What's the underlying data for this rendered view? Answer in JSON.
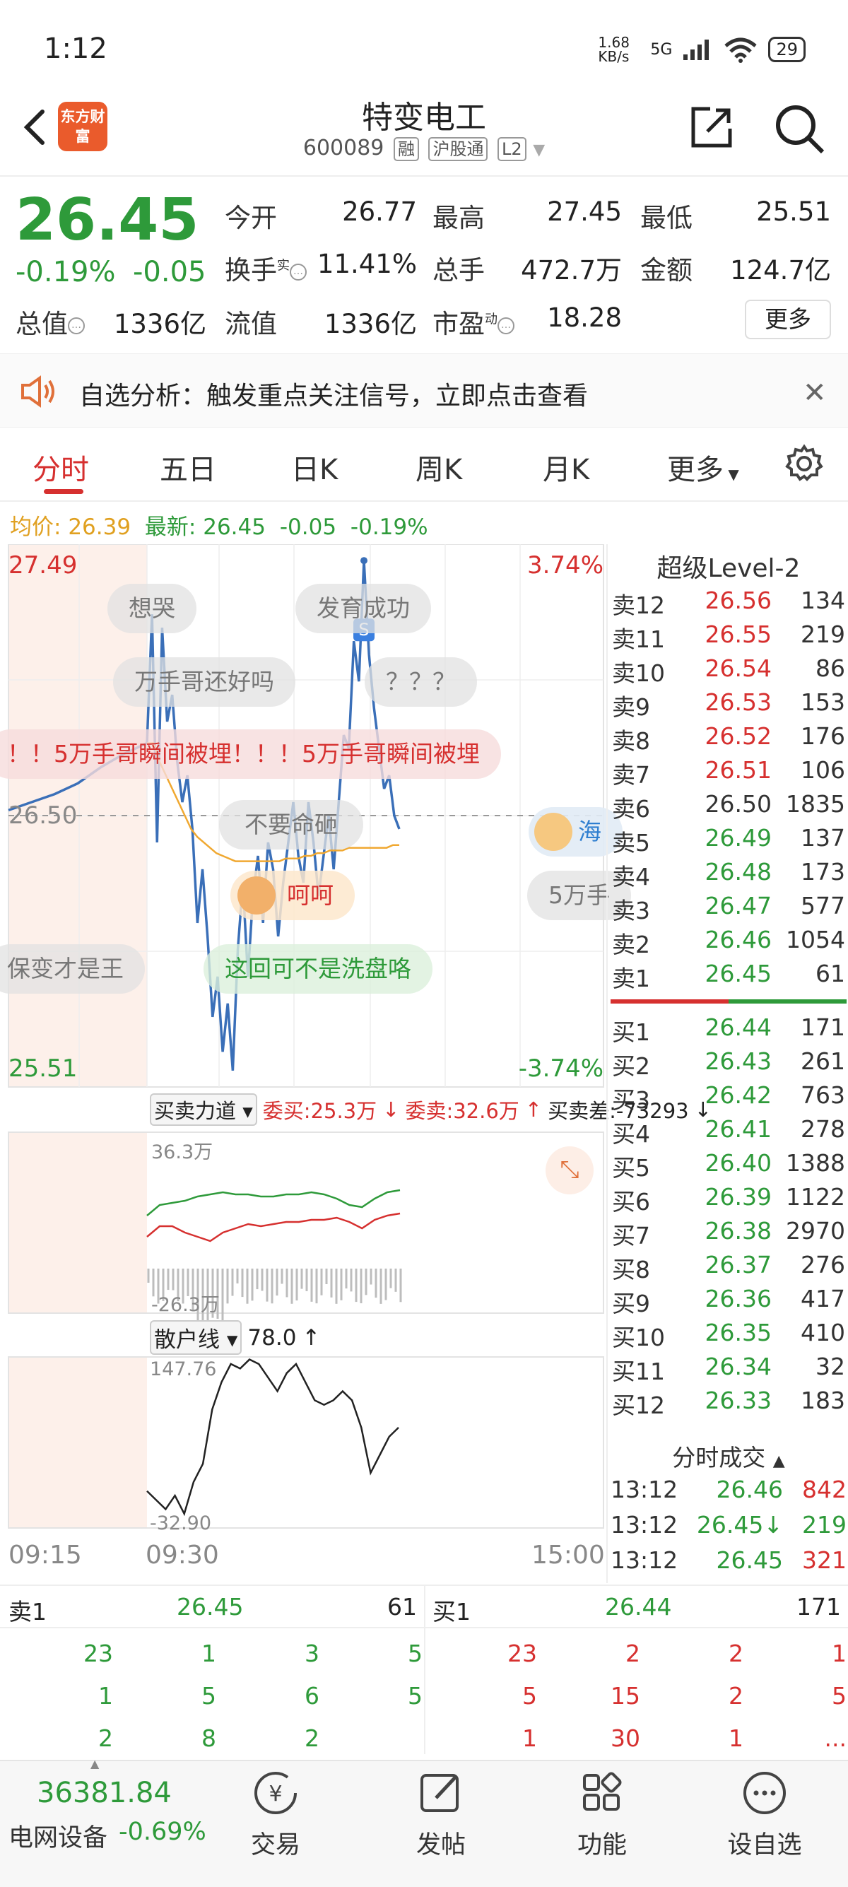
{
  "status_bar": {
    "time": "1:12",
    "net_speed": "1.68 KB/s",
    "network": "5G",
    "battery": "29"
  },
  "header": {
    "logo": "东方财富",
    "title": "特变电工",
    "code": "600089",
    "tags": [
      "融",
      "沪股通",
      "L2"
    ]
  },
  "quote": {
    "price": "26.45",
    "change_pct": "-0.19%",
    "change": "-0.05",
    "items": [
      {
        "label": "今开",
        "value": "26.77",
        "color": "#d6302f"
      },
      {
        "label": "最高",
        "value": "27.45",
        "color": "#d6302f"
      },
      {
        "label": "最低",
        "value": "25.51",
        "color": "#2e9a3a"
      },
      {
        "label": "换手",
        "sup": "实",
        "value": "11.41%",
        "color": "#333333"
      },
      {
        "label": "总手",
        "value": "472.7万",
        "color": "#333333"
      },
      {
        "label": "金额",
        "value": "124.7亿",
        "color": "#333333"
      },
      {
        "label": "总值",
        "value": "1336亿",
        "color": "#333333"
      },
      {
        "label": "流值",
        "value": "1336亿",
        "color": "#333333"
      },
      {
        "label": "市盈",
        "sup": "动",
        "value": "18.28",
        "color": "#333333"
      }
    ],
    "more": "更多"
  },
  "notice": {
    "text": "自选分析：触发重点关注信号，立即点击查看"
  },
  "tabs": {
    "items": [
      "分时",
      "五日",
      "日K",
      "周K",
      "月K",
      "更多"
    ],
    "active": 0
  },
  "avg_line": {
    "avg_label": "均价:",
    "avg_value": "26.39",
    "latest_label": "最新:",
    "latest_value": "26.45",
    "latest_change": "-0.05",
    "latest_pct": "-0.19%"
  },
  "chart_data": [
    {
      "type": "line",
      "title": "分时",
      "ylim": [
        25.51,
        27.49
      ],
      "y_left_labels": [
        "27.49",
        "26.50",
        "25.51"
      ],
      "y_right_labels": [
        "3.74%",
        "-3.74%"
      ],
      "x_labels": [
        "09:15",
        "09:30",
        "15:00"
      ],
      "series": [
        {
          "name": "价格",
          "color": "#3a6fb8",
          "values": [
            26.52,
            26.55,
            26.58,
            26.62,
            26.68,
            26.73,
            26.77,
            27.25,
            26.4,
            27.2,
            26.85,
            26.95,
            26.7,
            26.55,
            26.65,
            26.45,
            26.1,
            26.3,
            26.05,
            25.75,
            25.9,
            25.62,
            25.8,
            25.55,
            26.0,
            26.25,
            25.9,
            26.2,
            26.35,
            26.1,
            26.4,
            26.3,
            26.05,
            26.25,
            26.4,
            26.55,
            26.35,
            26.25,
            26.55,
            26.4,
            26.2,
            26.35,
            26.5,
            26.3,
            26.55,
            26.8,
            26.75,
            27.15,
            27.0,
            27.45,
            27.1,
            26.9,
            26.75,
            26.6,
            26.65,
            26.5,
            26.45
          ]
        },
        {
          "name": "均价",
          "color": "#f0a830",
          "values": [
            26.52,
            26.55,
            26.6,
            26.65,
            26.7,
            26.74,
            26.77,
            26.77,
            26.7,
            26.65,
            26.6,
            26.55,
            26.5,
            26.45,
            26.42,
            26.4,
            26.38,
            26.36,
            26.35,
            26.34,
            26.33,
            26.33,
            26.33,
            26.33,
            26.33,
            26.33,
            26.33,
            26.33,
            26.34,
            26.34,
            26.34,
            26.35,
            26.35,
            26.36,
            26.36,
            26.37,
            26.37,
            26.37,
            26.38,
            26.38,
            26.38,
            26.38,
            26.38,
            26.38,
            26.38,
            26.39,
            26.39
          ]
        }
      ]
    },
    {
      "type": "line",
      "title": "买卖力道",
      "header": {
        "label": "买卖力道",
        "weibuy": "委买:25.3万",
        "wesell": "委卖:32.6万",
        "diff": "买卖差:-73293"
      },
      "y_labels": [
        "36.3万",
        "-26.3万"
      ],
      "series": [
        {
          "name": "委卖",
          "color": "#2e9a3a",
          "values": [
            20,
            25,
            26,
            27,
            29,
            30,
            31,
            30,
            30,
            29,
            29,
            30,
            30,
            31,
            30,
            28,
            25,
            24,
            28,
            31,
            32
          ]
        },
        {
          "name": "委买",
          "color": "#d6302f",
          "values": [
            10,
            15,
            15,
            12,
            10,
            8,
            12,
            14,
            16,
            15,
            16,
            17,
            17,
            18,
            18,
            19,
            17,
            14,
            18,
            20,
            21
          ]
        }
      ]
    },
    {
      "type": "line",
      "title": "散户线",
      "header": {
        "label": "散户线",
        "value": "78.0"
      },
      "y_labels": [
        "147.76",
        "-32.90"
      ],
      "series": [
        {
          "name": "散户线",
          "color": "#222222",
          "values": [
            0,
            -10,
            -20,
            -5,
            -25,
            10,
            30,
            90,
            120,
            140,
            135,
            145,
            140,
            125,
            110,
            130,
            140,
            120,
            100,
            95,
            100,
            110,
            100,
            70,
            20,
            40,
            60,
            70
          ]
        }
      ]
    }
  ],
  "bubbles": [
    "想哭",
    "发育成功",
    "万手哥还好吗",
    "？？？",
    "！！5万手哥瞬间被埋！！！5万手哥瞬间被埋",
    "不要命砸",
    "呵呵",
    "5万手",
    "保变才是王",
    "这回可不是洗盘咯",
    "海"
  ],
  "order_book": {
    "title": "超级Level-2",
    "sells": [
      {
        "label": "卖12",
        "price": "26.56",
        "vol": "134"
      },
      {
        "label": "卖11",
        "price": "26.55",
        "vol": "219"
      },
      {
        "label": "卖10",
        "price": "26.54",
        "vol": "86"
      },
      {
        "label": "卖9",
        "price": "26.53",
        "vol": "153"
      },
      {
        "label": "卖8",
        "price": "26.52",
        "vol": "176"
      },
      {
        "label": "卖7",
        "price": "26.51",
        "vol": "106"
      },
      {
        "label": "卖6",
        "price": "26.50",
        "vol": "1835"
      },
      {
        "label": "卖5",
        "price": "26.49",
        "vol": "137"
      },
      {
        "label": "卖4",
        "price": "26.48",
        "vol": "173"
      },
      {
        "label": "卖3",
        "price": "26.47",
        "vol": "577"
      },
      {
        "label": "卖2",
        "price": "26.46",
        "vol": "1054"
      },
      {
        "label": "卖1",
        "price": "26.45",
        "vol": "61"
      }
    ],
    "buys": [
      {
        "label": "买1",
        "price": "26.44",
        "vol": "171"
      },
      {
        "label": "买2",
        "price": "26.43",
        "vol": "261"
      },
      {
        "label": "买3",
        "price": "26.42",
        "vol": "763"
      },
      {
        "label": "买4",
        "price": "26.41",
        "vol": "278"
      },
      {
        "label": "买5",
        "price": "26.40",
        "vol": "1388"
      },
      {
        "label": "买6",
        "price": "26.39",
        "vol": "1122"
      },
      {
        "label": "买7",
        "price": "26.38",
        "vol": "2970"
      },
      {
        "label": "买8",
        "price": "26.37",
        "vol": "276"
      },
      {
        "label": "买9",
        "price": "26.36",
        "vol": "417"
      },
      {
        "label": "买10",
        "price": "26.35",
        "vol": "410"
      },
      {
        "label": "买11",
        "price": "26.34",
        "vol": "32"
      },
      {
        "label": "买12",
        "price": "26.33",
        "vol": "183"
      }
    ]
  },
  "trades": {
    "title": "分时成交",
    "rows": [
      {
        "time": "13:12",
        "price": "26.46",
        "vol": "842",
        "vcolor": "#d6302f"
      },
      {
        "time": "13:12",
        "price": "26.45↓",
        "vol": "219",
        "vcolor": "#2e9a3a"
      },
      {
        "time": "13:12",
        "price": "26.45",
        "vol": "321",
        "vcolor": "#d6302f"
      }
    ]
  },
  "bottom_queue": {
    "sell": {
      "label": "卖1",
      "price": "26.45",
      "vol": "61",
      "rows": [
        [
          "23",
          "1",
          "3",
          "5"
        ],
        [
          "1",
          "5",
          "6",
          "5"
        ],
        [
          "2",
          "8",
          "2",
          ""
        ]
      ]
    },
    "buy": {
      "label": "买1",
      "price": "26.44",
      "vol": "171",
      "rows": [
        [
          "23",
          "2",
          "2",
          "1"
        ],
        [
          "5",
          "15",
          "2",
          "5"
        ],
        [
          "1",
          "30",
          "1",
          "..."
        ]
      ]
    }
  },
  "bottom_nav": {
    "index_value": "36381.84",
    "index_name": "电网设备",
    "index_change": "-0.69%",
    "items": [
      {
        "label": "交易",
        "icon": "trade-icon"
      },
      {
        "label": "发帖",
        "icon": "post-icon"
      },
      {
        "label": "功能",
        "icon": "grid-icon"
      },
      {
        "label": "设自选",
        "icon": "more-icon"
      }
    ]
  }
}
